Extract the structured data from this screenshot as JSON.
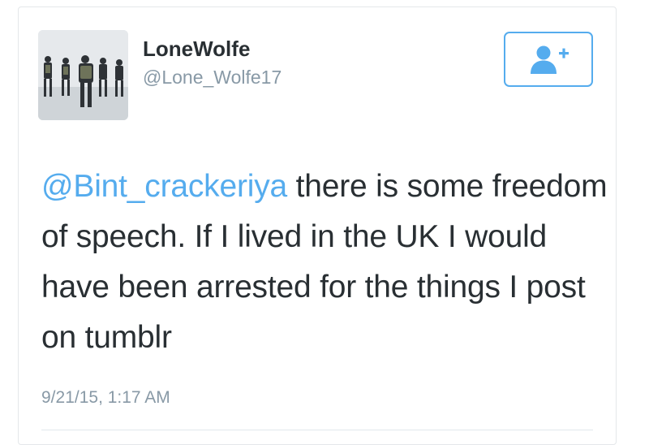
{
  "user": {
    "display_name": "LoneWolfe",
    "handle": "@Lone_Wolfe17"
  },
  "follow_button": {
    "icon": "add-user-icon",
    "color": "#55acee"
  },
  "tweet": {
    "mention": "@Bint_crackeriya",
    "text": " there is some freedom of speech. If I lived in the UK I would have been arrested for the things I post on tumblr",
    "timestamp": "9/21/15, 1:17 AM"
  },
  "colors": {
    "text": "#292f33",
    "muted": "#8899a6",
    "link": "#55acee"
  }
}
